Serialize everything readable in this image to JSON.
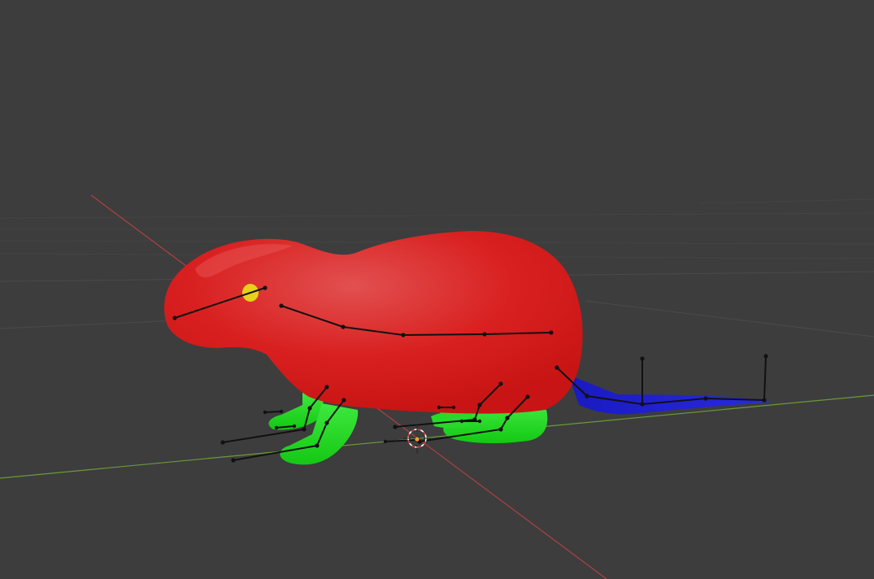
{
  "viewport": {
    "background_color": "#3d3d3d",
    "grid_color": "#4a4a4a",
    "x_axis_color": "#b04040",
    "y_axis_color": "#6a9a3a"
  },
  "model": {
    "body_color": "#d91e1e",
    "body_highlight": "#e04a4a",
    "feet_color": "#1fdc1f",
    "tail_color": "#1e1ed8",
    "eye_color": "#e6d21a",
    "armature_color": "#111111"
  },
  "cursor_3d": {
    "icon": "3d-cursor-icon",
    "colors": [
      "#ffffff",
      "#d04040"
    ]
  },
  "origin_marker": {
    "icon": "object-origin-icon",
    "color": "#ff9b2a"
  }
}
